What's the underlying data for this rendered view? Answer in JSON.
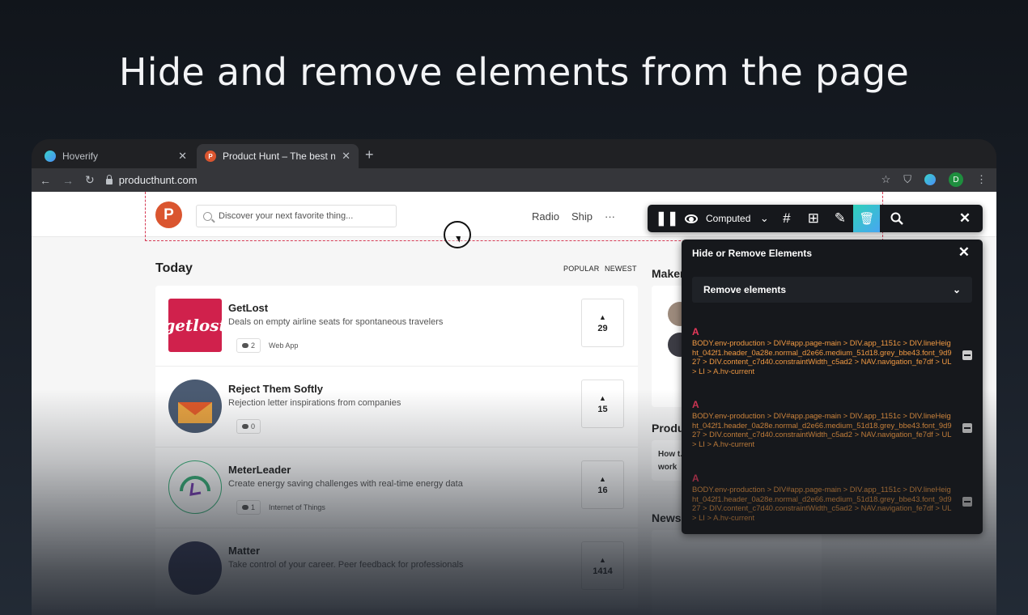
{
  "headline": "Hide and remove elements from the page",
  "browser": {
    "tabs": [
      {
        "title": "Hoverify",
        "favicon": "hoverify-icon"
      },
      {
        "title": "Product Hunt – The best new products",
        "favicon": "producthunt-icon",
        "active": true
      }
    ],
    "new_tab": "+",
    "url": "producthunt.com",
    "profile_initial": "D"
  },
  "ph": {
    "logo": "P",
    "search_placeholder": "Discover your next favorite thing...",
    "nav": [
      "Radio",
      "Ship",
      "···"
    ],
    "section_title": "Today",
    "sort_popular": "POPULAR",
    "sort_newest": "NEWEST",
    "posts": [
      {
        "name": "GetLost",
        "tagline": "Deals on empty airline seats for spontaneous travelers",
        "comments": "2",
        "topic": "Web App",
        "votes": "29",
        "thumb_text": "getlost"
      },
      {
        "name": "Reject Them Softly",
        "tagline": "Rejection letter inspirations from companies",
        "comments": "0",
        "topic": "",
        "votes": "15"
      },
      {
        "name": "MeterLeader",
        "tagline": "Create energy saving challenges with real-time energy data",
        "comments": "1",
        "topic": "Internet of Things",
        "votes": "16"
      },
      {
        "name": "Matter",
        "tagline": "Take control of your career. Peer feedback for professionals",
        "comments": "",
        "topic": "",
        "votes": "1414"
      }
    ],
    "sidebar": {
      "makers_title": "Makers working today",
      "products_title": "Produc",
      "products_snippet": "How t... work",
      "news_title": "Newsl"
    }
  },
  "tool": {
    "toolbar": {
      "computed_label": "Computed",
      "colors": {
        "bg": "#16181c",
        "accent_from": "#2ed1b9",
        "accent_to": "#48a6f2"
      }
    },
    "panel": {
      "title": "Hide or Remove Elements",
      "mode": "Remove elements",
      "entries": [
        {
          "tag": "A",
          "path": "BODY.env-production > DIV#app.page-main > DIV.app_1151c > DIV.lineHeight_042f1.header_0a28e.normal_d2e66.medium_51d18.grey_bbe43.font_9d927 > DIV.content_c7d40.constraintWidth_c5ad2 > NAV.navigation_fe7df > UL > LI > A.hv-current"
        },
        {
          "tag": "A",
          "path": "BODY.env-production > DIV#app.page-main > DIV.app_1151c > DIV.lineHeight_042f1.header_0a28e.normal_d2e66.medium_51d18.grey_bbe43.font_9d927 > DIV.content_c7d40.constraintWidth_c5ad2 > NAV.navigation_fe7df > UL > LI > A.hv-current"
        },
        {
          "tag": "A",
          "path": "BODY.env-production > DIV#app.page-main > DIV.app_1151c > DIV.lineHeight_042f1.header_0a28e.normal_d2e66.medium_51d18.grey_bbe43.font_9d927 > DIV.content_c7d40.constraintWidth_c5ad2 > NAV.navigation_fe7df > UL > LI > A.hv-current"
        }
      ],
      "colors": {
        "tag": "#e8395b",
        "path": "#f29a43"
      }
    }
  }
}
